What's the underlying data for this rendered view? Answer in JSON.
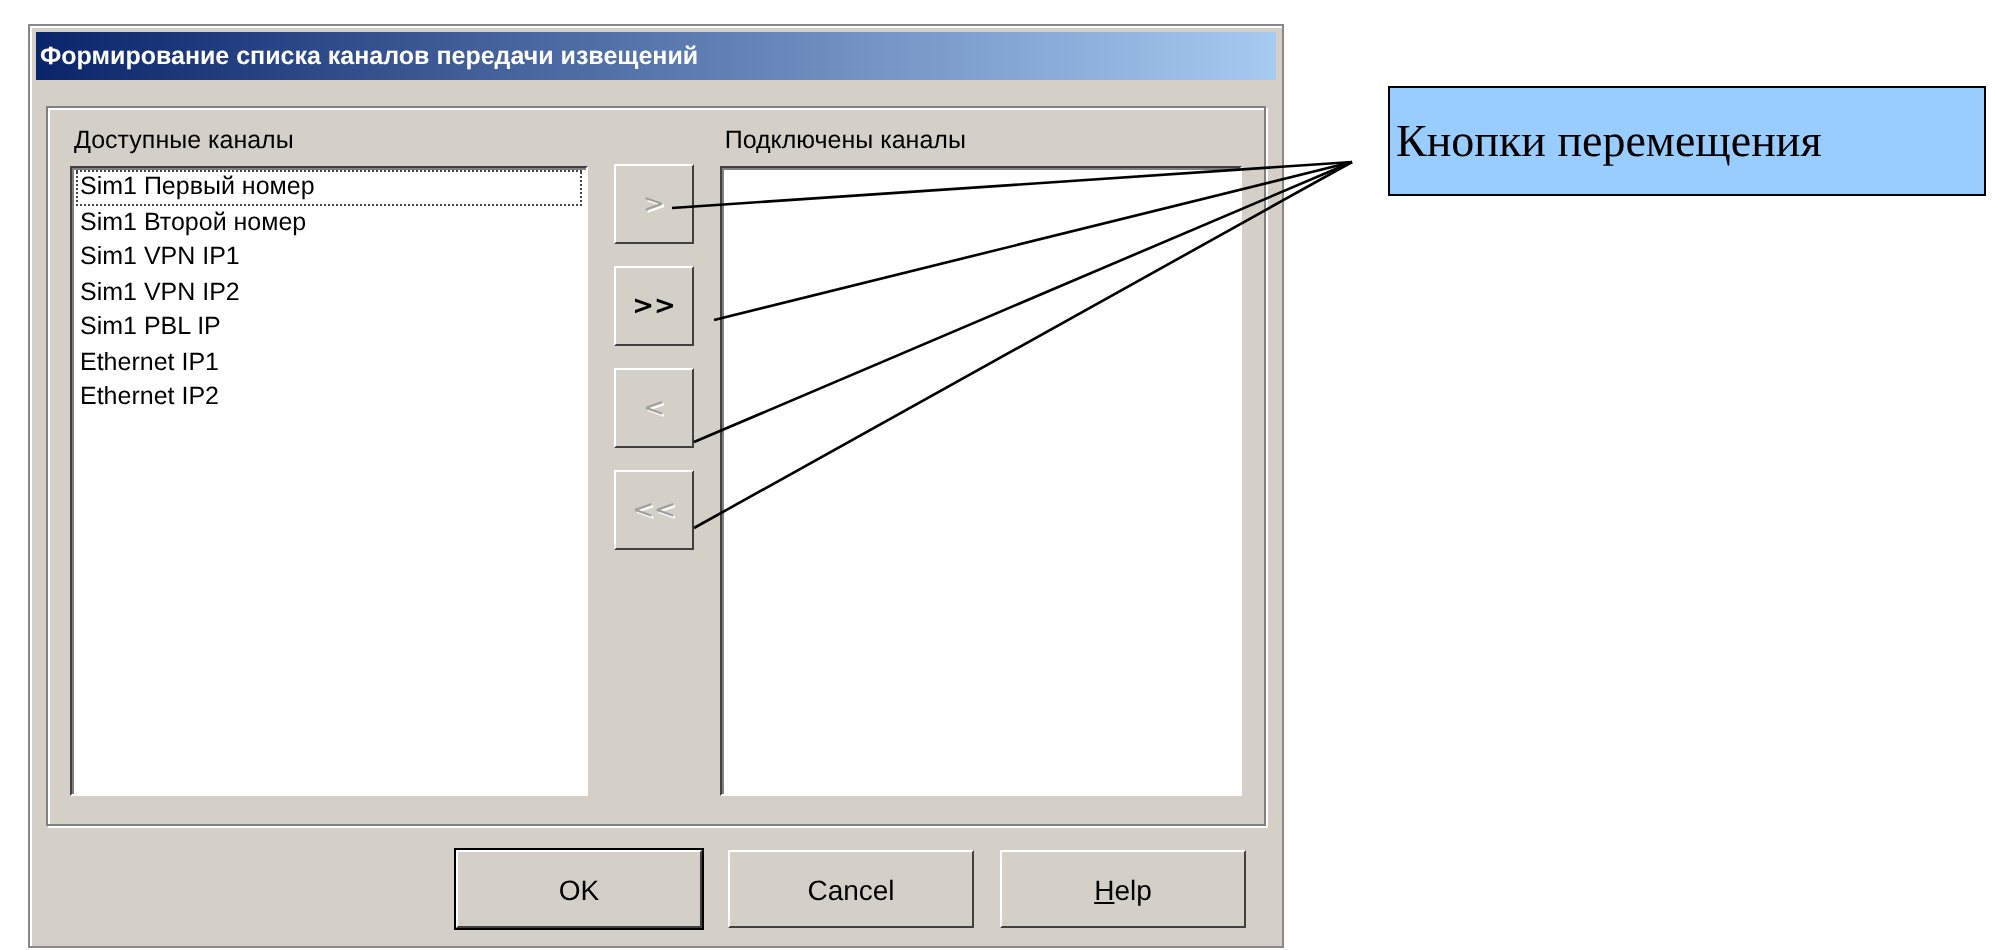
{
  "window": {
    "title": "Формирование списка каналов передачи извещений"
  },
  "available": {
    "label": "Доступные каналы",
    "items": [
      {
        "text": "Sim1 Первый номер",
        "focused": true
      },
      {
        "text": "Sim1 Второй номер",
        "focused": false
      },
      {
        "text": "Sim1 VPN IP1",
        "focused": false
      },
      {
        "text": "Sim1 VPN IP2",
        "focused": false
      },
      {
        "text": "Sim1 PBL IP",
        "focused": false
      },
      {
        "text": "Ethernet IP1",
        "focused": false
      },
      {
        "text": "Ethernet IP2",
        "focused": false
      }
    ]
  },
  "move_buttons": [
    {
      "label": ">",
      "disabled": true
    },
    {
      "label": ">>",
      "disabled": false
    },
    {
      "label": "<",
      "disabled": true
    },
    {
      "label": "<<",
      "disabled": true
    }
  ],
  "connected": {
    "label": "Подключены каналы"
  },
  "buttons": [
    {
      "label": "OK",
      "access_key": false
    },
    {
      "label": "Cancel",
      "access_key": false
    },
    {
      "label": "Help",
      "access_key": true
    }
  ],
  "callout": {
    "text": "Кнопки перемещения"
  }
}
